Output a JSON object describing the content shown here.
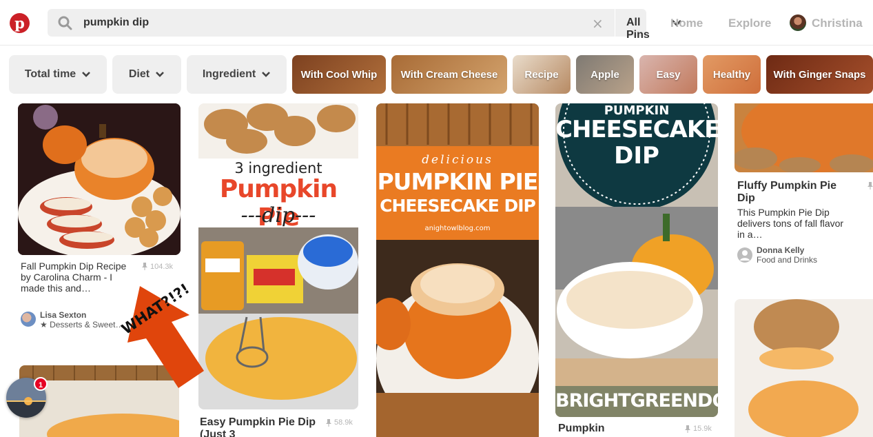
{
  "header": {
    "search_query": "pumpkin dip",
    "clear_glyph": "×",
    "scope_label": "All Pins",
    "nav_home": "Home",
    "nav_explore": "Explore",
    "user_name": "Christina",
    "brand_color": "#cb2027"
  },
  "filters": [
    {
      "label": "Total time"
    },
    {
      "label": "Diet"
    },
    {
      "label": "Ingredient"
    }
  ],
  "guides": [
    {
      "label": "With Cool Whip",
      "color": "#9b5a2a"
    },
    {
      "label": "With Cream Cheese",
      "color": "#c08a52"
    },
    {
      "label": "Recipe",
      "color": "#d7c2a8"
    },
    {
      "label": "Apple",
      "color": "#9f8f7f"
    },
    {
      "label": "Easy",
      "color": "#cda39a"
    },
    {
      "label": "Healthy",
      "color": "#d98550"
    },
    {
      "label": "With Ginger Snaps",
      "color": "#8e3a1c"
    }
  ],
  "pins": {
    "p1": {
      "title": "Fall Pumpkin Dip Recipe by Carolina Charm - I made this and…",
      "saves": "104.3k",
      "pinner": "Lisa Sexton",
      "board": "★ Desserts & Sweet…"
    },
    "p2": {
      "img_line1": "3 ingredient",
      "img_line2": "Pumpkin Pie",
      "img_line3": "---dip---",
      "title": "Easy Pumpkin Pie Dip (Just 3",
      "saves": "58.9k"
    },
    "p3": {
      "img_line1": "delicious",
      "img_line2": "PUMPKIN PIE",
      "img_line3": "CHEESECAKE DIP",
      "img_line4": "anightowlblog.com"
    },
    "p4": {
      "img_line1": "PUMPKIN",
      "img_line2": "CHEESECAKE",
      "img_line3": "DIP",
      "img_footer": "BRIGHTGREENDOOR",
      "title": "Pumpkin",
      "saves": "15.9k"
    },
    "p5": {
      "title": "Fluffy Pumpkin Pie Dip",
      "desc": "This Pumpkin Pie Dip delivers tons of fall flavor in a…",
      "pinner": "Donna Kelly",
      "board": "Food and Drinks"
    }
  },
  "annotation": {
    "text": "WHAT?!?!",
    "color": "#e0450c"
  },
  "notification": {
    "count": "1"
  }
}
